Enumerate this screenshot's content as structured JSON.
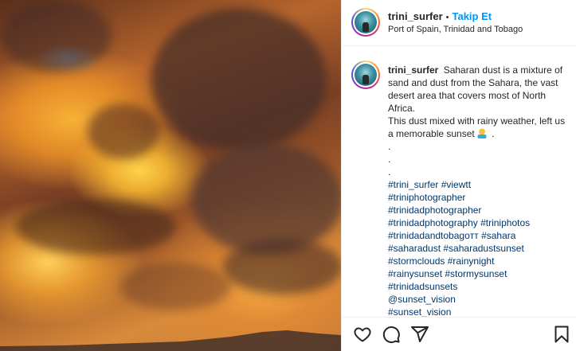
{
  "post": {
    "username": "trini_surfer",
    "separator": "•",
    "follow_label": "Takip Et",
    "location": "Port of Spain, Trinidad and Tobago"
  },
  "caption": {
    "username": "trini_surfer",
    "text_line1": "Saharan dust is a mixture of sand and dust from the Sahara, the vast desert area that covers most of North Africa.",
    "text_line2": "This dust mixed with rainy weather, left us a memorable sunset",
    "text_line2_end": ".",
    "dots": [
      ".",
      ".",
      "."
    ],
    "hashtags": [
      "#trini_surfer #viewtt",
      "#triniphotographer",
      "#trinidadphotographer",
      "#trinidadphotography #triniphotos",
      "#trinidadandtobagoтт #sahara",
      "#saharadust #saharadustsunset",
      "#stormclouds #rainynight",
      "#rainysunset #stormysunset",
      "#trinidadsunsets",
      "@sunset_vision",
      "#sunset_vision"
    ]
  },
  "actions": {
    "icons": [
      "heart-icon",
      "comment-icon",
      "share-icon",
      "bookmark-icon"
    ]
  }
}
